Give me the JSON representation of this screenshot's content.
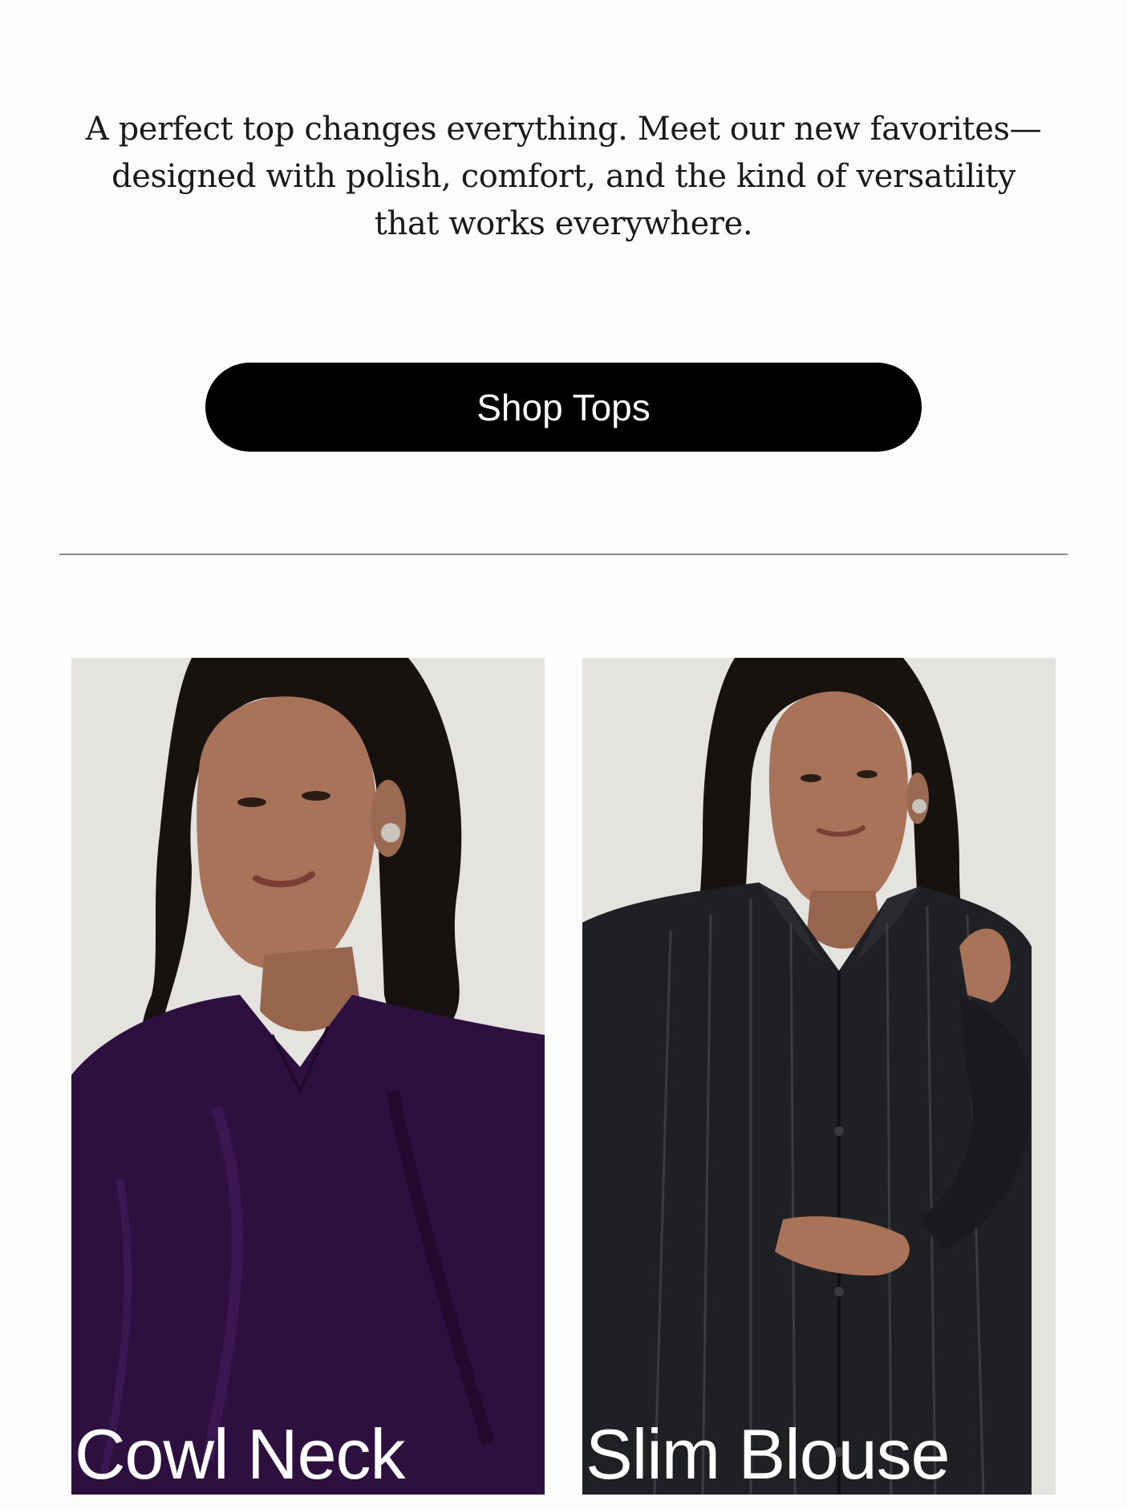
{
  "intro": {
    "line1": "A perfect top changes everything. Meet our new favorites—",
    "line2": "designed with polish, comfort, and the kind of versatility",
    "line3": "that works everywhere."
  },
  "cta": {
    "label": "Shop Tops"
  },
  "products": [
    {
      "label": "Cowl Neck",
      "garment_color": "#2e1040"
    },
    {
      "label": "Slim Blouse",
      "garment_color": "#1f2024"
    }
  ],
  "colors": {
    "page_background": "#fcfcfc",
    "button_background": "#000000",
    "button_text": "#ffffff",
    "photo_background": "#e4e3df"
  }
}
